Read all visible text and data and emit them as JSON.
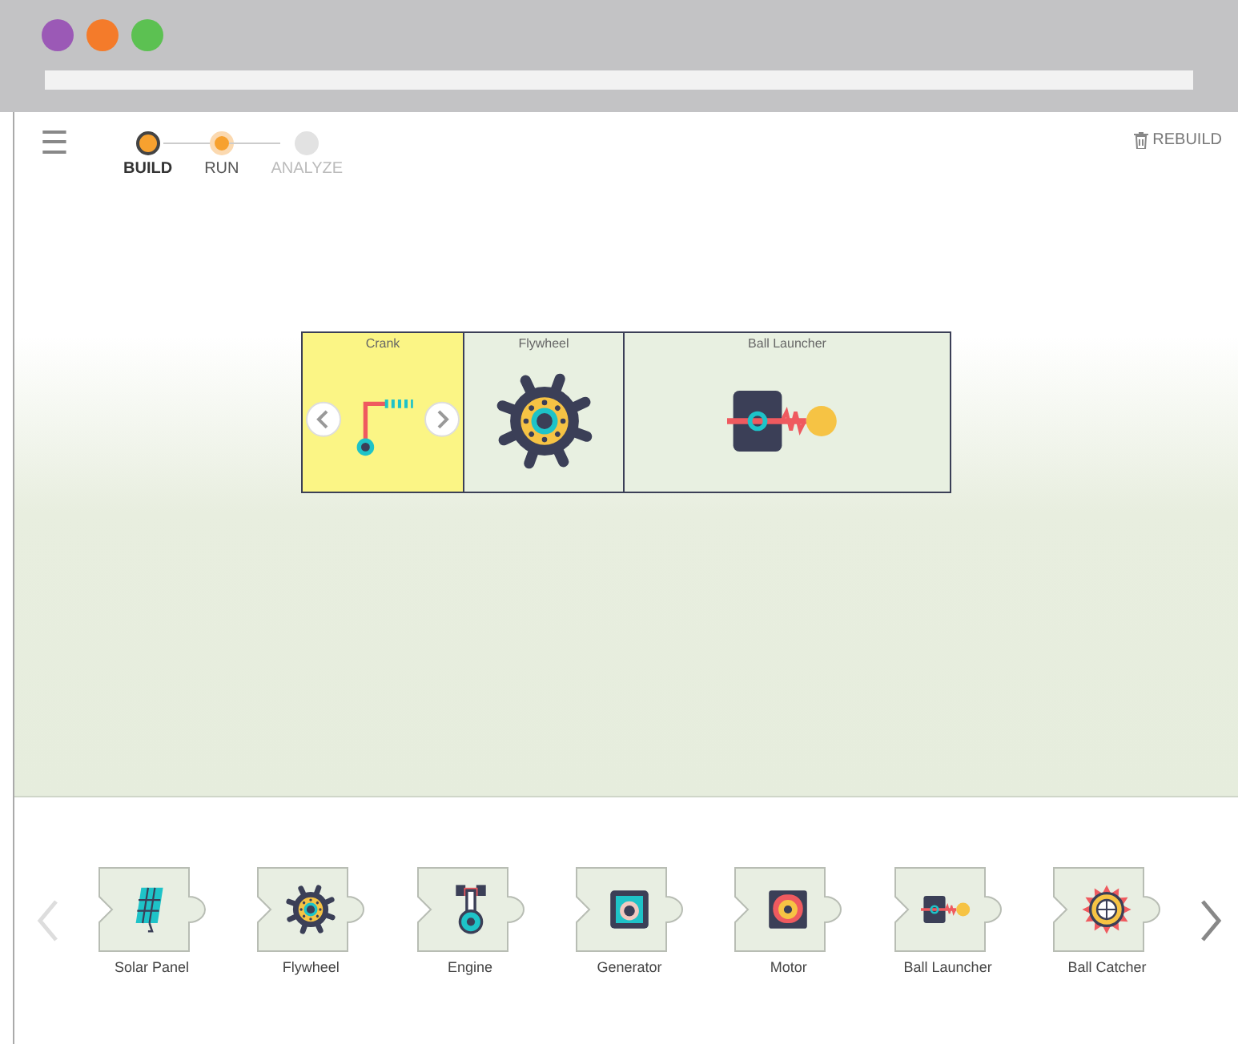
{
  "menu": {
    "label": "☰"
  },
  "steps": [
    {
      "label": "BUILD",
      "selected": true,
      "disabled": false
    },
    {
      "label": "RUN",
      "selected": false,
      "disabled": false
    },
    {
      "label": "ANALYZE",
      "selected": false,
      "disabled": true
    }
  ],
  "rebuild": {
    "label": "REBUILD"
  },
  "assembly": [
    {
      "name": "Crank",
      "kind": "crank",
      "selected": true
    },
    {
      "name": "Flywheel",
      "kind": "flywheel",
      "selected": false
    },
    {
      "name": "Ball Launcher",
      "kind": "ball-launcher",
      "selected": false
    }
  ],
  "tray": {
    "prev_disabled": true,
    "next_disabled": false,
    "parts": [
      {
        "name": "Solar Panel",
        "kind": "solar-panel"
      },
      {
        "name": "Flywheel",
        "kind": "flywheel"
      },
      {
        "name": "Engine",
        "kind": "engine"
      },
      {
        "name": "Generator",
        "kind": "generator"
      },
      {
        "name": "Motor",
        "kind": "motor"
      },
      {
        "name": "Ball Launcher",
        "kind": "ball-launcher"
      },
      {
        "name": "Ball Catcher",
        "kind": "ball-catcher"
      }
    ]
  }
}
